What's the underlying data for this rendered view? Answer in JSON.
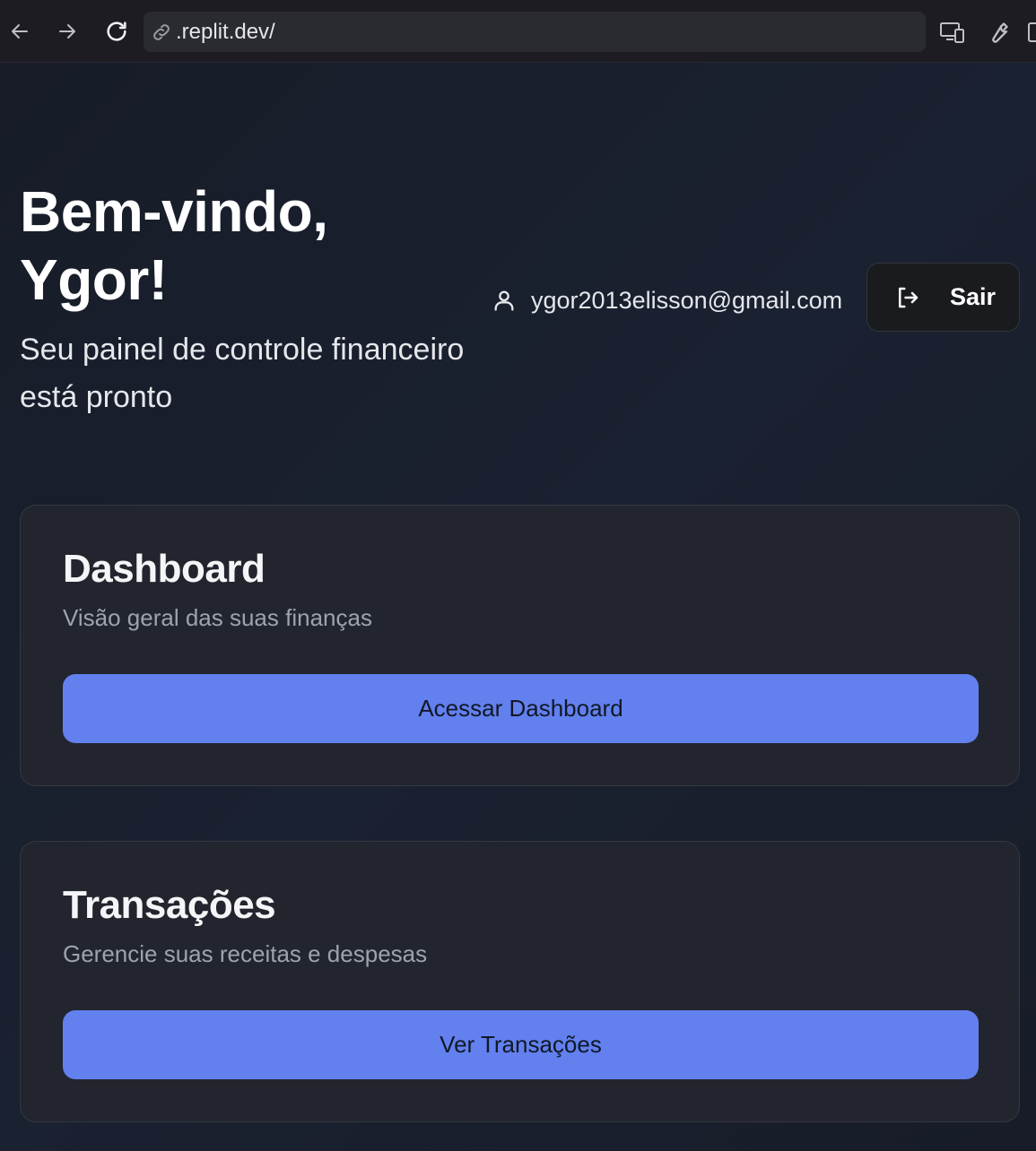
{
  "browser": {
    "url": ".replit.dev/",
    "icons": [
      "back-arrow-icon",
      "forward-arrow-icon",
      "reload-icon",
      "link-icon",
      "responsive-devices-icon",
      "wrench-icon"
    ]
  },
  "header": {
    "title": "Bem-vindo, Ygor!",
    "subtitle": "Seu painel de controle financeiro está pronto",
    "user_email": "ygor2013elisson@gmail.com",
    "logout_label": "Sair"
  },
  "cards": [
    {
      "title": "Dashboard",
      "description": "Visão geral das suas finanças",
      "button_label": "Acessar Dashboard"
    },
    {
      "title": "Transações",
      "description": "Gerencie suas receitas e despesas",
      "button_label": "Ver Transações"
    }
  ],
  "colors": {
    "background": "#171c28",
    "card": "#22252e",
    "accent": "#6280ee"
  }
}
